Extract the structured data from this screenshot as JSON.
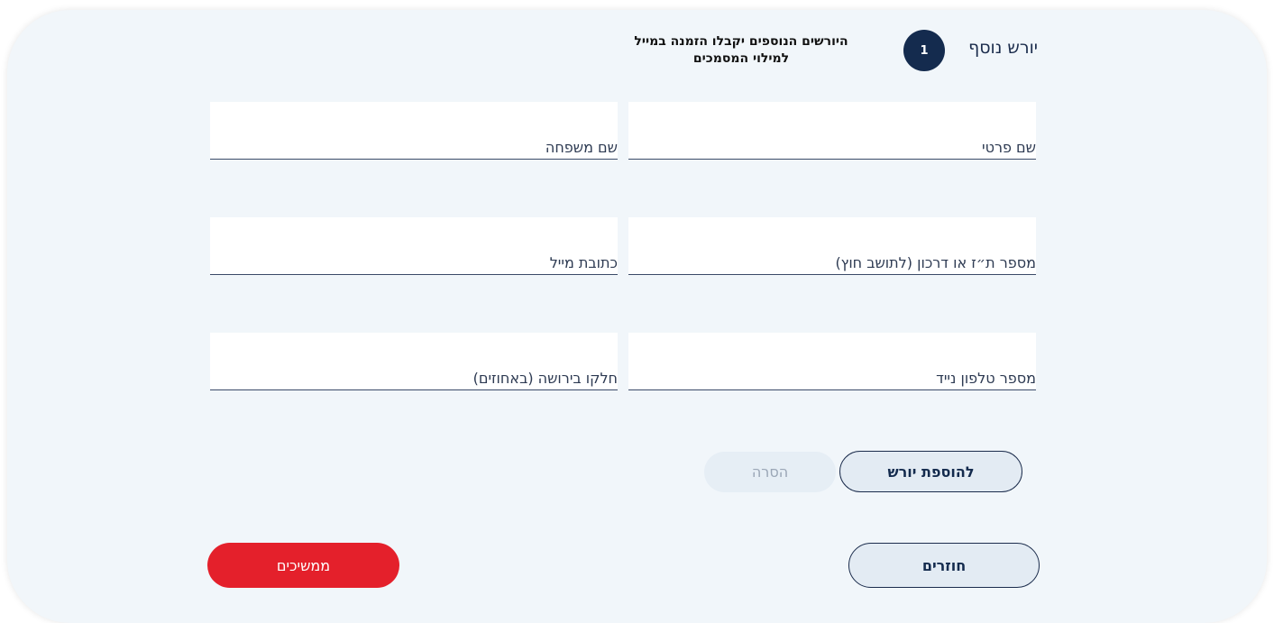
{
  "header": {
    "title": "יורש נוסף",
    "step_number": "1",
    "note_line1": "היורשים הנוספים יקבלו הזמנה במייל",
    "note_line2": "למילוי המסמכים"
  },
  "form": {
    "first_name_label": "שם פרטי",
    "last_name_label": "שם משפחה",
    "id_label": "מספר ת״ז או דרכון (לתושב חוץ)",
    "email_label": "כתובת מייל",
    "phone_label": "מספר טלפון נייד",
    "share_label": "חלקו בירושה (באחוזים)"
  },
  "actions": {
    "add_heir_label": "להוספת יורש",
    "remove_label": "הסרה",
    "back_label": "חוזרים",
    "continue_label": "ממשיכים"
  },
  "colors": {
    "primary_navy": "#142b4e",
    "accent_red": "#e4202b",
    "card_background": "#f1f6fa"
  }
}
